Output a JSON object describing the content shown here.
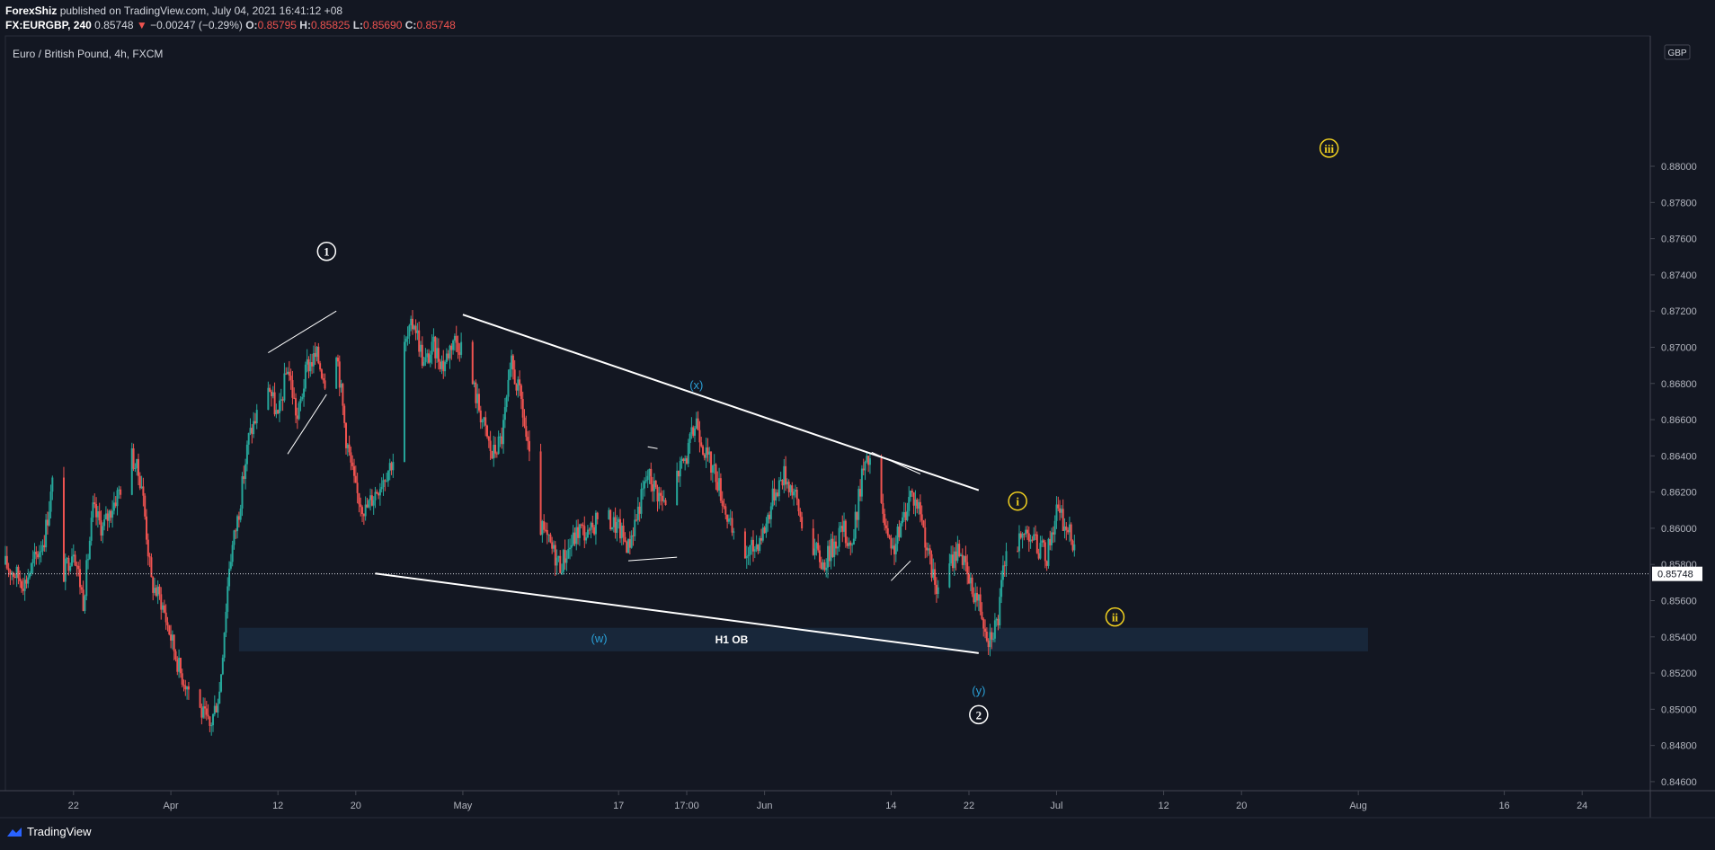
{
  "header": {
    "author": "ForexShiz",
    "published": "published on TradingView.com, July 04, 2021 16:41:12 +08",
    "symbol": "FX:EURGBP, 240",
    "last": "0.85748",
    "change": "−0.00247 (−0.29%)",
    "open_label": "O:",
    "open": "0.85795",
    "high_label": "H:",
    "high": "0.85825",
    "low_label": "L:",
    "low": "0.85690",
    "close_label": "C:",
    "close": "0.85748"
  },
  "footer": {
    "brand": "TradingView"
  },
  "colors": {
    "background": "#131722",
    "bull": "#26a69a",
    "bear": "#ef5350",
    "wave_white": "#ffffff",
    "wave_cyan": "#2a9fd6",
    "wave_yellow": "#f0d020",
    "order_block": "#1a2a3e",
    "price_tag": "#ffffff"
  },
  "chart_data": {
    "type": "candlestick",
    "title": "Euro / British Pound, 4h, FXCM",
    "currency": "GBP",
    "ylim": [
      0.8455,
      0.8872
    ],
    "y_ticks": [
      "0.88000",
      "0.87800",
      "0.87600",
      "0.87400",
      "0.87200",
      "0.87000",
      "0.86800",
      "0.86600",
      "0.86400",
      "0.86200",
      "0.86000",
      "0.85800",
      "0.85600",
      "0.85400",
      "0.85200",
      "0.85000",
      "0.84800",
      "0.84600"
    ],
    "x_range": [
      "2021-03-15",
      "2021-08-31"
    ],
    "x_ticks": [
      {
        "date": "2021-03-22",
        "label": "22"
      },
      {
        "date": "2021-04-01",
        "label": "Apr"
      },
      {
        "date": "2021-04-12",
        "label": "12"
      },
      {
        "date": "2021-04-20",
        "label": "20"
      },
      {
        "date": "2021-05-01",
        "label": "May"
      },
      {
        "date": "2021-05-17",
        "label": "17"
      },
      {
        "date": "2021-05-24",
        "label": "17:00"
      },
      {
        "date": "2021-06-01",
        "label": "Jun"
      },
      {
        "date": "2021-06-14",
        "label": "14"
      },
      {
        "date": "2021-06-22",
        "label": "22"
      },
      {
        "date": "2021-07-01",
        "label": "Jul"
      },
      {
        "date": "2021-07-12",
        "label": "12"
      },
      {
        "date": "2021-07-20",
        "label": "20"
      },
      {
        "date": "2021-08-01",
        "label": "Aug"
      },
      {
        "date": "2021-08-16",
        "label": "16"
      },
      {
        "date": "2021-08-24",
        "label": "24"
      }
    ],
    "last_price": 0.85748,
    "last_price_label": "0.85748",
    "price_path": [
      [
        "2021-03-15",
        0.858
      ],
      [
        "2021-03-17",
        0.857
      ],
      [
        "2021-03-19",
        0.8595
      ],
      [
        "2021-03-20",
        0.863
      ],
      [
        "2021-03-21",
        0.8575
      ],
      [
        "2021-03-22",
        0.859
      ],
      [
        "2021-03-23",
        0.856
      ],
      [
        "2021-03-24",
        0.861
      ],
      [
        "2021-03-25",
        0.86
      ],
      [
        "2021-03-27",
        0.8625
      ],
      [
        "2021-03-28",
        0.864
      ],
      [
        "2021-03-29",
        0.8625
      ],
      [
        "2021-03-30",
        0.857
      ],
      [
        "2021-03-31",
        0.856
      ],
      [
        "2021-04-02",
        0.852
      ],
      [
        "2021-04-04",
        0.85
      ],
      [
        "2021-04-05",
        0.849
      ],
      [
        "2021-04-06",
        0.851
      ],
      [
        "2021-04-07",
        0.858
      ],
      [
        "2021-04-08",
        0.861
      ],
      [
        "2021-04-09",
        0.865
      ],
      [
        "2021-04-11",
        0.868
      ],
      [
        "2021-04-12",
        0.866
      ],
      [
        "2021-04-13",
        0.869
      ],
      [
        "2021-04-14",
        0.866
      ],
      [
        "2021-04-15",
        0.869
      ],
      [
        "2021-04-16",
        0.8695
      ],
      [
        "2021-04-17",
        0.868
      ],
      [
        "2021-04-18",
        0.87
      ],
      [
        "2021-04-19",
        0.865
      ],
      [
        "2021-04-20",
        0.862
      ],
      [
        "2021-04-21",
        0.861
      ],
      [
        "2021-04-22",
        0.862
      ],
      [
        "2021-04-24",
        0.864
      ],
      [
        "2021-04-25",
        0.87
      ],
      [
        "2021-04-26",
        0.8715
      ],
      [
        "2021-04-27",
        0.869
      ],
      [
        "2021-04-28",
        0.87
      ],
      [
        "2021-04-29",
        0.869
      ],
      [
        "2021-04-30",
        0.8705
      ],
      [
        "2021-05-01",
        0.87
      ],
      [
        "2021-05-02",
        0.868
      ],
      [
        "2021-05-03",
        0.866
      ],
      [
        "2021-05-04",
        0.864
      ],
      [
        "2021-05-05",
        0.865
      ],
      [
        "2021-05-06",
        0.869
      ],
      [
        "2021-05-07",
        0.867
      ],
      [
        "2021-05-08",
        0.863
      ],
      [
        "2021-05-09",
        0.86
      ],
      [
        "2021-05-10",
        0.859
      ],
      [
        "2021-05-11",
        0.858
      ],
      [
        "2021-05-12",
        0.859
      ],
      [
        "2021-05-13",
        0.86
      ],
      [
        "2021-05-14",
        0.8595
      ],
      [
        "2021-05-15",
        0.861
      ],
      [
        "2021-05-16",
        0.8605
      ],
      [
        "2021-05-17",
        0.86
      ],
      [
        "2021-05-18",
        0.859
      ],
      [
        "2021-05-19",
        0.861
      ],
      [
        "2021-05-20",
        0.863
      ],
      [
        "2021-05-21",
        0.862
      ],
      [
        "2021-05-22",
        0.861
      ],
      [
        "2021-05-23",
        0.863
      ],
      [
        "2021-05-24",
        0.864
      ],
      [
        "2021-05-25",
        0.866
      ],
      [
        "2021-05-26",
        0.864
      ],
      [
        "2021-05-27",
        0.863
      ],
      [
        "2021-05-28",
        0.861
      ],
      [
        "2021-05-29",
        0.859
      ],
      [
        "2021-05-30",
        0.8585
      ],
      [
        "2021-05-31",
        0.859
      ],
      [
        "2021-06-01",
        0.86
      ],
      [
        "2021-06-02",
        0.862
      ],
      [
        "2021-06-03",
        0.863
      ],
      [
        "2021-06-04",
        0.862
      ],
      [
        "2021-06-05",
        0.86
      ],
      [
        "2021-06-06",
        0.859
      ],
      [
        "2021-06-07",
        0.858
      ],
      [
        "2021-06-08",
        0.859
      ],
      [
        "2021-06-09",
        0.86
      ],
      [
        "2021-06-10",
        0.859
      ],
      [
        "2021-06-11",
        0.863
      ],
      [
        "2021-06-12",
        0.864
      ],
      [
        "2021-06-13",
        0.861
      ],
      [
        "2021-06-14",
        0.8585
      ],
      [
        "2021-06-15",
        0.86
      ],
      [
        "2021-06-16",
        0.862
      ],
      [
        "2021-06-17",
        0.861
      ],
      [
        "2021-06-18",
        0.858
      ],
      [
        "2021-06-19",
        0.856
      ],
      [
        "2021-06-20",
        0.858
      ],
      [
        "2021-06-21",
        0.859
      ],
      [
        "2021-06-22",
        0.857
      ],
      [
        "2021-06-23",
        0.856
      ],
      [
        "2021-06-24",
        0.854
      ],
      [
        "2021-06-25",
        0.855
      ],
      [
        "2021-06-26",
        0.86
      ],
      [
        "2021-06-27",
        0.859
      ],
      [
        "2021-06-28",
        0.86
      ],
      [
        "2021-06-29",
        0.859
      ],
      [
        "2021-06-30",
        0.8585
      ],
      [
        "2021-07-01",
        0.861
      ],
      [
        "2021-07-02",
        0.86
      ],
      [
        "2021-07-03",
        0.859
      ],
      [
        "2021-07-04",
        0.85748
      ]
    ],
    "trendlines": [
      {
        "from": [
          "2021-05-01",
          0.8718
        ],
        "to": [
          "2021-06-23",
          0.8621
        ]
      },
      {
        "from": [
          "2021-04-22",
          0.8575
        ],
        "to": [
          "2021-06-23",
          0.8531
        ]
      }
    ],
    "wave_labels": [
      {
        "text": "1",
        "date": "2021-04-17",
        "price": 0.8753,
        "style": "circle-white"
      },
      {
        "text": "2",
        "date": "2021-06-23",
        "price": 0.8497,
        "style": "circle-white"
      },
      {
        "text": "(x)",
        "date": "2021-05-25",
        "price": 0.8679,
        "style": "cyan"
      },
      {
        "text": "(w)",
        "date": "2021-05-15",
        "price": 0.8539,
        "style": "cyan"
      },
      {
        "text": "(y)",
        "date": "2021-06-23",
        "price": 0.851,
        "style": "cyan"
      },
      {
        "text": "i",
        "date": "2021-06-27",
        "price": 0.8615,
        "style": "circle-yellow"
      },
      {
        "text": "ii",
        "date": "2021-07-07",
        "price": 0.8551,
        "style": "circle-yellow"
      },
      {
        "text": "iii",
        "date": "2021-07-29",
        "price": 0.881,
        "style": "circle-yellow"
      }
    ],
    "zones": [
      {
        "label": "H1 OB",
        "from_date": "2021-04-08",
        "to_date": "2021-08-02",
        "top": 0.8545,
        "bottom": 0.8532
      }
    ]
  }
}
